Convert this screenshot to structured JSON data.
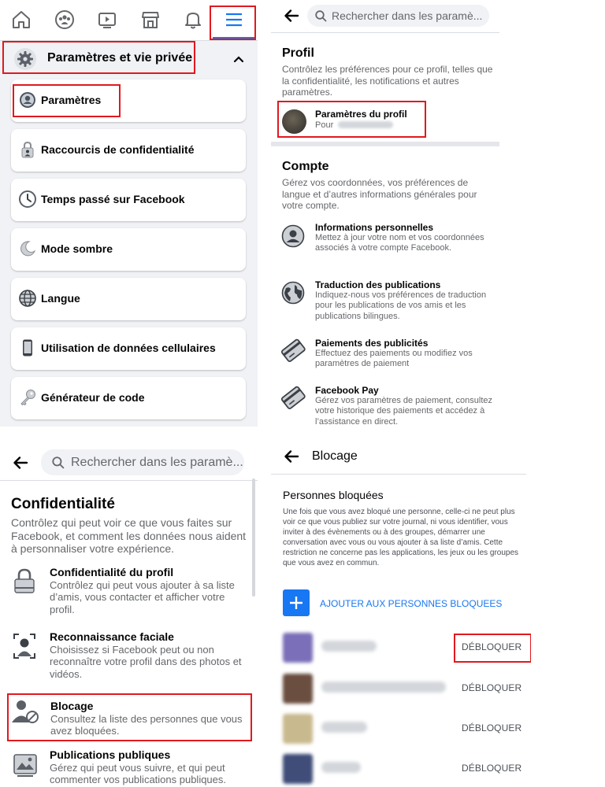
{
  "colors": {
    "accent": "#1877f2",
    "highlight_box": "#e0191f",
    "text_primary": "#050505",
    "text_secondary": "#65676b",
    "menu_background": "#f0f2f5"
  },
  "top_nav": {
    "icons": [
      "home-icon",
      "groups-icon",
      "watch-icon",
      "marketplace-icon",
      "notifications-bell-icon",
      "hamburger-menu-icon"
    ],
    "active": "hamburger-menu-icon"
  },
  "menu": {
    "section_title": "Paramètres et vie privée",
    "section_icon": "gear-icon",
    "items": [
      {
        "label": "Paramètres",
        "icon": "profile-circle-icon"
      },
      {
        "label": "Raccourcis de confidentialité",
        "icon": "lock-person-icon"
      },
      {
        "label": "Temps passé sur Facebook",
        "icon": "clock-icon"
      },
      {
        "label": "Mode sombre",
        "icon": "moon-icon"
      },
      {
        "label": "Langue",
        "icon": "globe-icon"
      },
      {
        "label": "Utilisation de données cellulaires",
        "icon": "phone-icon"
      },
      {
        "label": "Générateur de code",
        "icon": "key-icon"
      }
    ]
  },
  "settings": {
    "search_placeholder": "Rechercher dans les paramè...",
    "profil": {
      "title": "Profil",
      "desc": "Contrôlez les préférences pour ce profil, telles que la confidentialité, les notifications et autres paramètres.",
      "row_title": "Paramètres du profil",
      "row_sub": "Pour"
    },
    "compte": {
      "title": "Compte",
      "desc": "Gérez vos coordonnées, vos préférences de langue et d’autres informations générales pour votre compte.",
      "rows": [
        {
          "title": "Informations personnelles",
          "desc": "Mettez à jour votre nom et vos coordonnées associés à votre compte Facebook.",
          "icon": "person-circle-icon"
        },
        {
          "title": "Traduction des publications",
          "desc": "Indiquez-nous vos préférences de traduction pour les publications de vos amis et les publications bilingues.",
          "icon": "globe-icon"
        },
        {
          "title": "Paiements des publicités",
          "desc": "Effectuez des paiements ou modifiez vos paramètres de paiement",
          "icon": "credit-card-icon"
        },
        {
          "title": "Facebook Pay",
          "desc": "Gérez vos paramètres de paiement, consultez votre historique des paiements et accédez à l’assistance en direct.",
          "icon": "credit-card-icon"
        }
      ]
    }
  },
  "privacy": {
    "search_placeholder": "Rechercher dans les paramè...",
    "title": "Confidentialité",
    "desc": "Contrôlez qui peut voir ce que vous faites sur Facebook, et comment les données nous aident à personnaliser votre expérience.",
    "rows": [
      {
        "title": "Confidentialité du profil",
        "desc": "Contrôlez qui peut vous ajouter à sa liste d’amis, vous contacter et afficher votre profil.",
        "icon": "padlock-icon"
      },
      {
        "title": "Reconnaissance faciale",
        "desc": "Choisissez si Facebook peut ou non reconnaître votre profil dans des photos et vidéos.",
        "icon": "face-recognition-icon"
      },
      {
        "title": "Blocage",
        "desc": "Consultez la liste des personnes que vous avez bloquées.",
        "icon": "blocked-person-icon"
      },
      {
        "title": "Publications publiques",
        "desc": "Gérez qui peut vous suivre, et qui peut commenter vos publications publiques.",
        "icon": "public-post-icon"
      }
    ]
  },
  "blocking": {
    "header": "Blocage",
    "subtitle": "Personnes bloquées",
    "desc": "Une fois que vous avez bloqué une personne, celle-ci ne peut plus voir ce que vous publiez sur votre journal, ni vous identifier, vous inviter à des évènements ou à des groupes, démarrer une conversation avec vous ou vous ajouter à sa liste d’amis. Cette restriction ne concerne pas les applications, les jeux ou les groupes que vous avez en commun.",
    "add_label": "AJOUTER AUX PERSONNES BLOQUEES",
    "unblock_label": "DÉBLOQUER",
    "people": [
      {
        "avatar_color": "#7a6fb8"
      },
      {
        "avatar_color": "#6a4e3f"
      },
      {
        "avatar_color": "#c9b98f"
      },
      {
        "avatar_color": "#3f4d78"
      }
    ]
  }
}
